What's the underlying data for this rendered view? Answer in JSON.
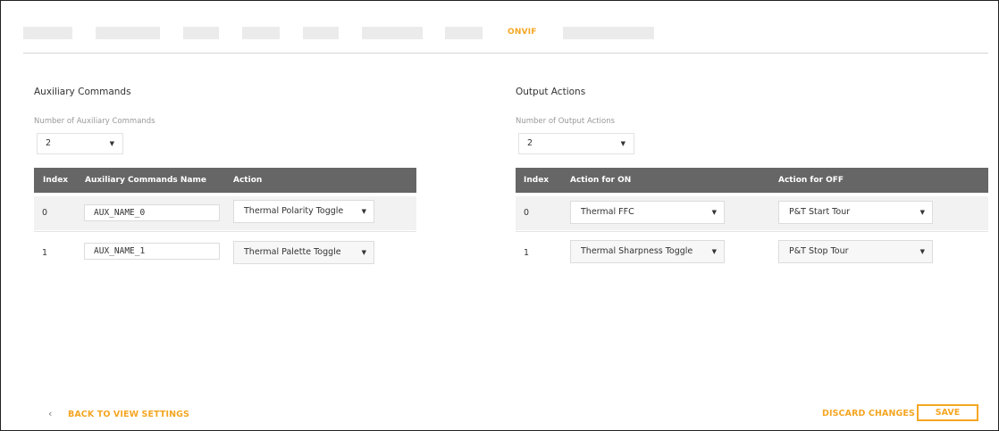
{
  "tabs": {
    "active_label": "ONVIF"
  },
  "aux": {
    "title": "Auxiliary Commands",
    "count_label": "Number of Auxiliary Commands",
    "count_value": "2",
    "headers": [
      "Index",
      "Auxiliary Commands Name",
      "Action"
    ],
    "rows": [
      {
        "index": "0",
        "name": "AUX_NAME_0",
        "action": "Thermal Polarity Toggle"
      },
      {
        "index": "1",
        "name": "AUX_NAME_1",
        "action": "Thermal Palette Toggle"
      }
    ]
  },
  "output": {
    "title": "Output Actions",
    "count_label": "Number of Output Actions",
    "count_value": "2",
    "headers": [
      "Index",
      "Action for ON",
      "Action for OFF"
    ],
    "rows": [
      {
        "index": "0",
        "on": "Thermal FFC",
        "off": "P&T Start Tour"
      },
      {
        "index": "1",
        "on": "Thermal Sharpness Toggle",
        "off": "P&T Stop Tour"
      }
    ]
  },
  "footer": {
    "back_label": "BACK TO VIEW SETTINGS",
    "discard_label": "DISCARD CHANGES",
    "save_label": "SAVE"
  },
  "colors": {
    "accent": "#f5a623",
    "table_header": "#666666"
  },
  "icons": {
    "dropdown": "caret-down-icon",
    "back": "chevron-left-icon"
  }
}
